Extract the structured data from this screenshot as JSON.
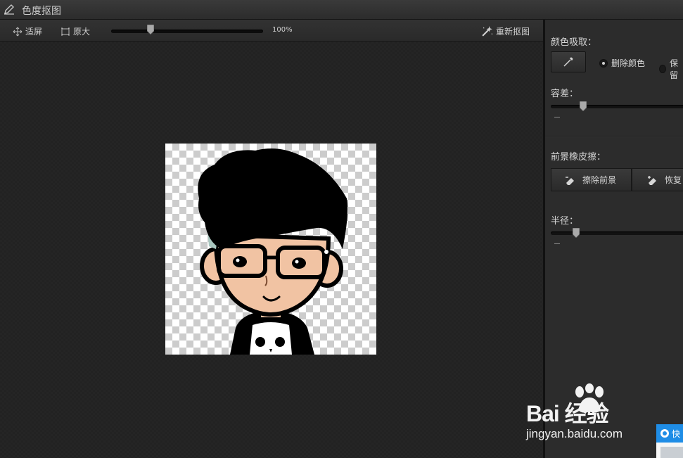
{
  "window": {
    "title": "色度抠图",
    "icon": "pen-icon"
  },
  "toolbar": {
    "fit_label": "适屏",
    "original_label": "原大",
    "zoom_percent": "100%",
    "zoom_value": 0.26,
    "reselect_label": "重新抠图"
  },
  "panel": {
    "color_pick_label": "颜色吸取：",
    "remove_color_label": "删除颜色",
    "keep_color_label": "保留",
    "remove_color_selected": true,
    "tolerance_label": "容差：",
    "tolerance_value": 0.24,
    "eraser_label": "前景橡皮擦：",
    "erase_fg_label": "擦除前景",
    "restore_label": "恢复",
    "radius_label": "半径：",
    "radius_value": 0.19
  },
  "watermark": {
    "brand": "Bai  经验",
    "site": "jingyan.baidu.com"
  },
  "popup": {
    "label": "快"
  }
}
